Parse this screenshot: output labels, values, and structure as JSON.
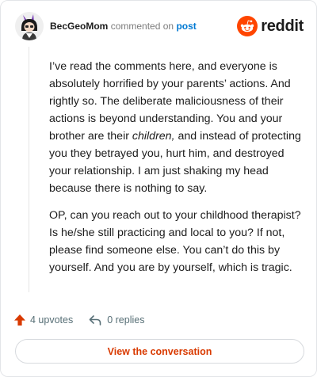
{
  "header": {
    "username": "BecGeoMom",
    "action": "commented on",
    "post_link": "post",
    "brand": "reddit",
    "brand_color": "#ff4500"
  },
  "comment": {
    "paragraph1_part1": "I’ve read the comments here, and everyone is absolutely horrified by your parents’ actions. And rightly so. The deliberate maliciousness of their actions is beyond understanding. You and your brother are their ",
    "paragraph1_emphasis": "children,",
    "paragraph1_part2": " and instead of protecting you they betrayed you, hurt him, and destroyed your relationship. I am just shaking my head because there is nothing to say.",
    "paragraph2": "OP, can you reach out to your childhood therapist? Is he/she still practicing and local to you? If not, please find someone else. You can’t do this by yourself. And you are by yourself, which is tragic."
  },
  "footer": {
    "upvotes": "4 upvotes",
    "replies": "0 replies",
    "view_button": "View the conversation",
    "upvote_icon": "arrow-up-icon",
    "reply_icon": "reply-arrow-icon",
    "accent_color": "#d93a00"
  }
}
